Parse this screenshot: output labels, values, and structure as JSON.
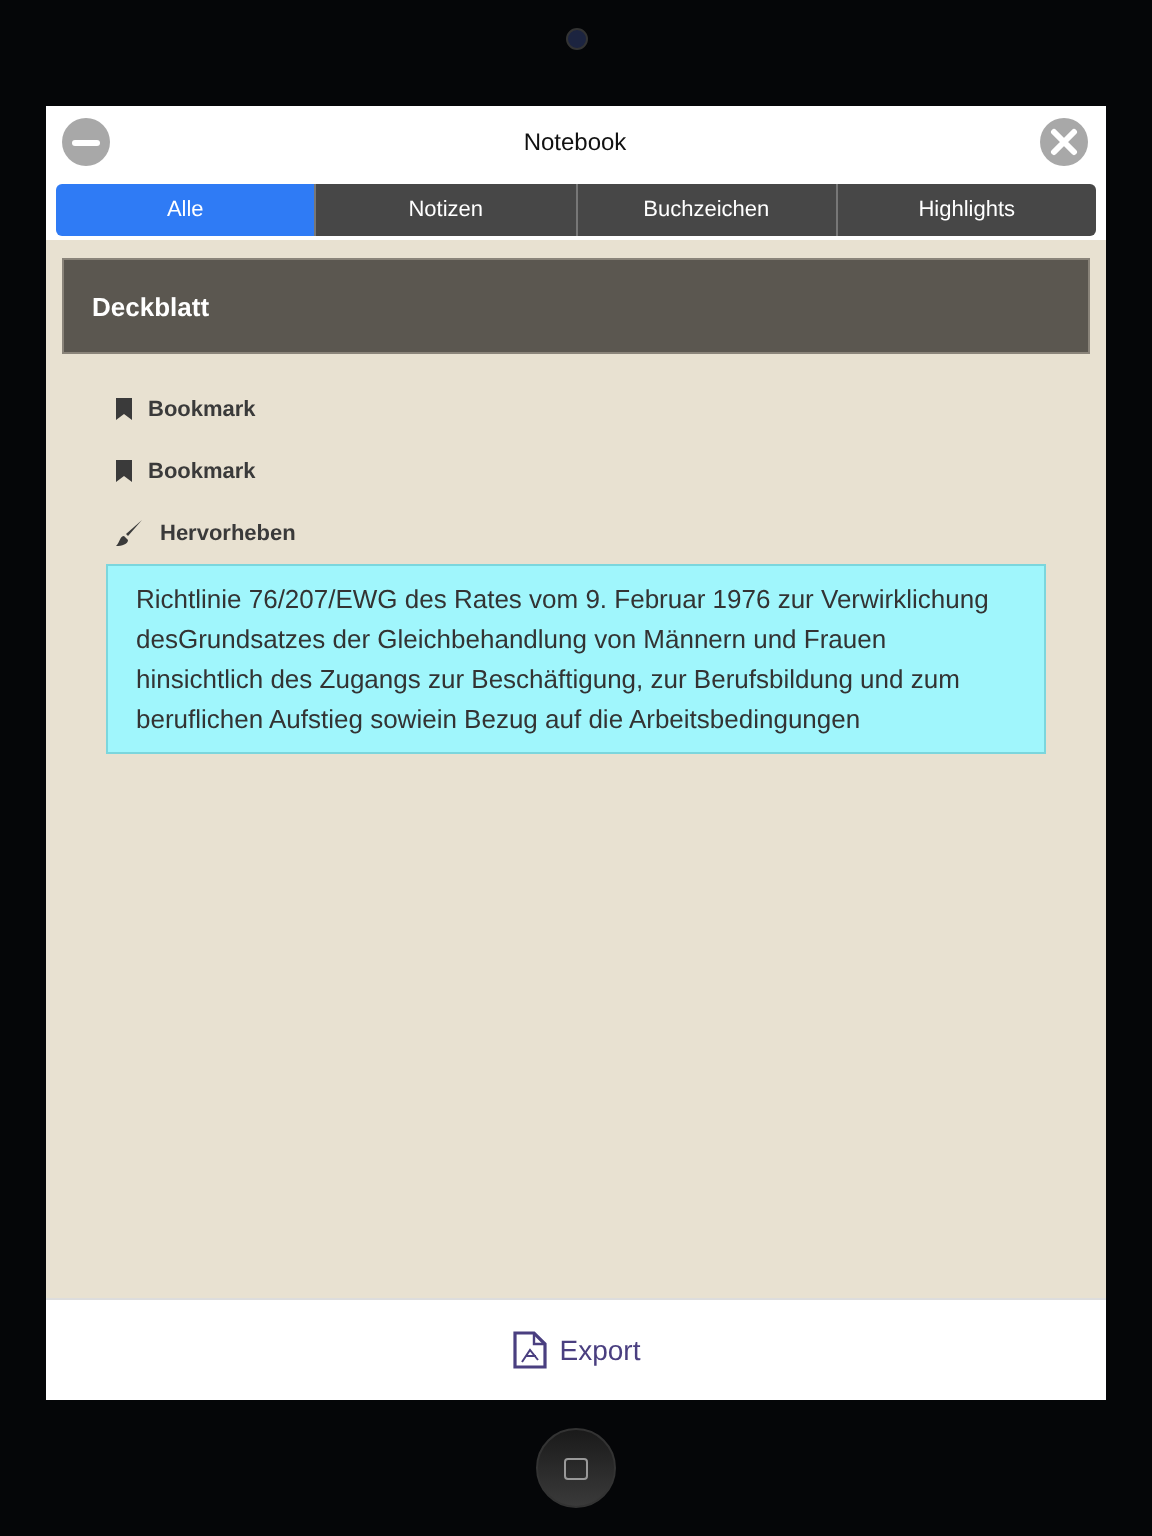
{
  "window": {
    "title": "Notebook"
  },
  "tabs": [
    {
      "label": "Alle",
      "selected": true
    },
    {
      "label": "Notizen",
      "selected": false
    },
    {
      "label": "Buchzeichen",
      "selected": false
    },
    {
      "label": "Highlights",
      "selected": false
    }
  ],
  "section": {
    "title": "Deckblatt"
  },
  "items": [
    {
      "kind": "bookmark",
      "label": "Bookmark"
    },
    {
      "kind": "bookmark",
      "label": "Bookmark"
    },
    {
      "kind": "highlight",
      "label": "Hervorheben",
      "text": "Richtlinie 76/207/EWG des Rates vom 9. Februar 1976 zur Verwirklichung desGrundsatzes der Gleichbehandlung von Männern und Frauen hinsichtlich des Zugangs zur Beschäftigung, zur Berufsbildung und zum beruflichen Aufstieg sowiein Bezug auf die Arbeitsbedingungen",
      "color": "#a0f6fc"
    }
  ],
  "footer": {
    "export_label": "Export"
  }
}
